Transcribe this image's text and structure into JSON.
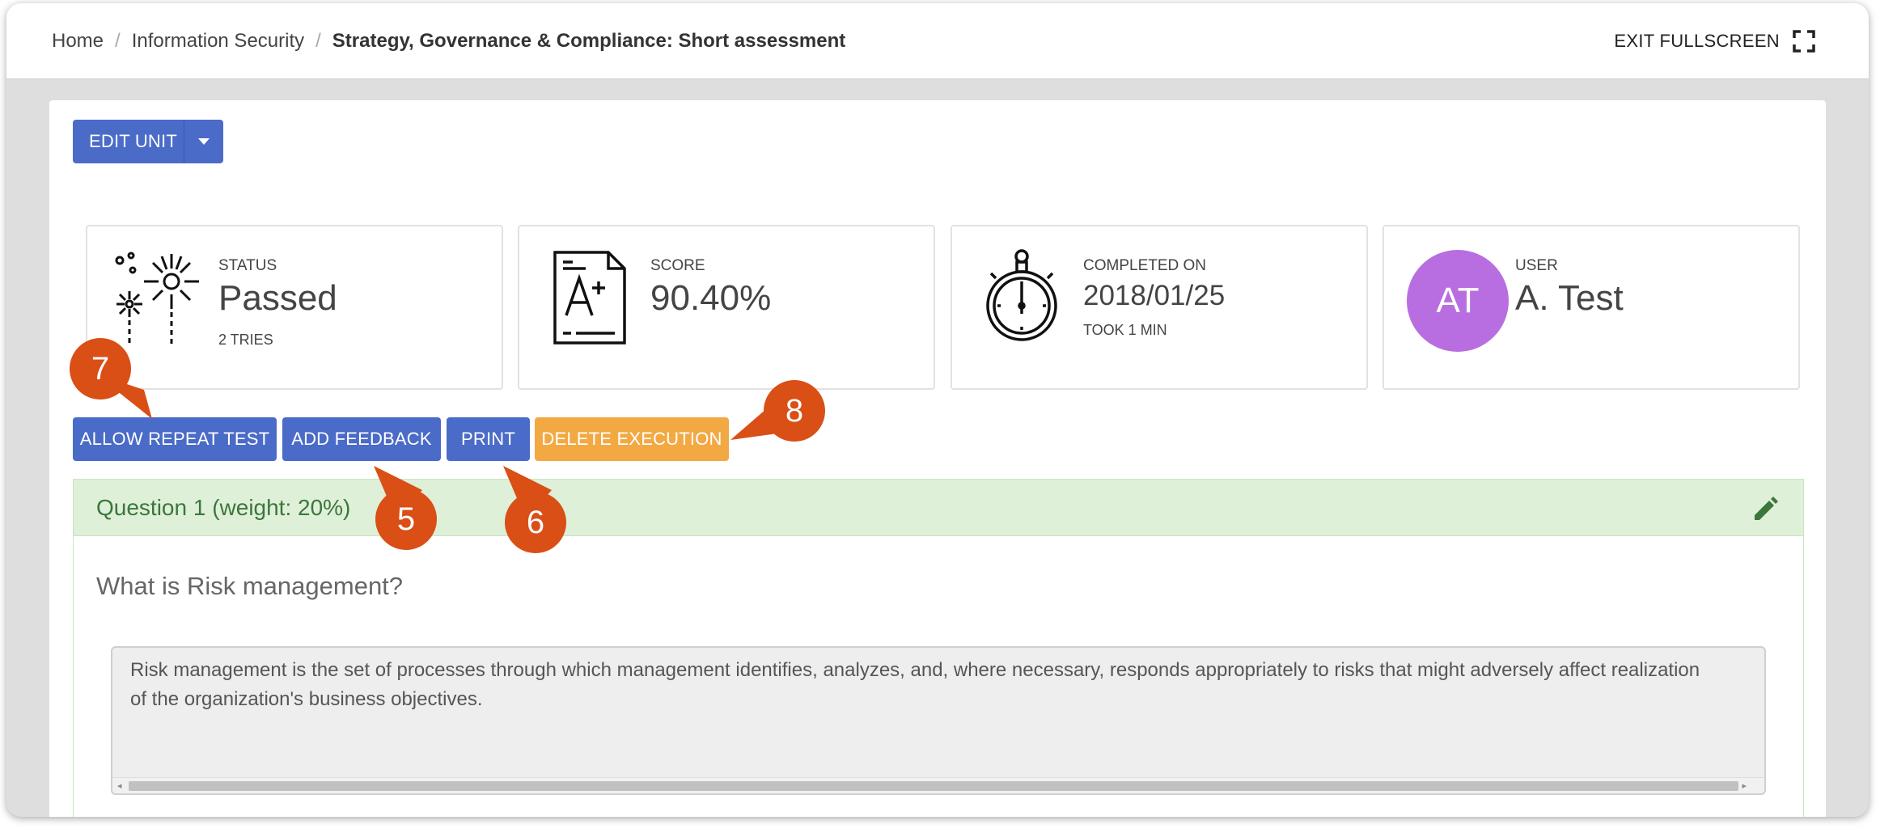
{
  "breadcrumb": {
    "home": "Home",
    "section": "Information Security",
    "current": "Strategy, Governance & Compliance: Short assessment"
  },
  "header": {
    "exit_fullscreen": "EXIT FULLSCREEN"
  },
  "toolbar": {
    "edit_unit": "EDIT UNIT"
  },
  "stats": {
    "status": {
      "label": "STATUS",
      "value": "Passed",
      "sub": "2 TRIES"
    },
    "score": {
      "label": "SCORE",
      "value": "90.40%"
    },
    "completed": {
      "label": "COMPLETED ON",
      "value": "2018/01/25",
      "sub": "TOOK 1 MIN"
    },
    "user": {
      "label": "USER",
      "value": "A. Test",
      "initials": "AT"
    }
  },
  "actions": {
    "allow_repeat": "ALLOW REPEAT TEST",
    "add_feedback": "ADD FEEDBACK",
    "print": "PRINT",
    "delete_execution": "DELETE EXECUTION"
  },
  "question": {
    "title": "Question 1 (weight: 20%)",
    "text": "What is Risk management?",
    "answer": "Risk management is the set of processes through which management identifies, analyzes, and, where necessary, responds appropriately to risks that might adversely affect realization of the organization's business objectives."
  },
  "callouts": {
    "c5": "5",
    "c6": "6",
    "c7": "7",
    "c8": "8"
  },
  "colors": {
    "primary": "#4a6bc7",
    "warning": "#f3a943",
    "success_bg": "#dff0d8",
    "success_text": "#3c763d",
    "avatar": "#b86ee0",
    "callout": "#d94f15"
  },
  "icons": {
    "fullscreen": "fullscreen-icon",
    "fireworks": "fireworks-icon",
    "grade": "grade-document-icon",
    "stopwatch": "stopwatch-icon",
    "pencil": "pencil-icon",
    "caret": "caret-down-icon"
  }
}
